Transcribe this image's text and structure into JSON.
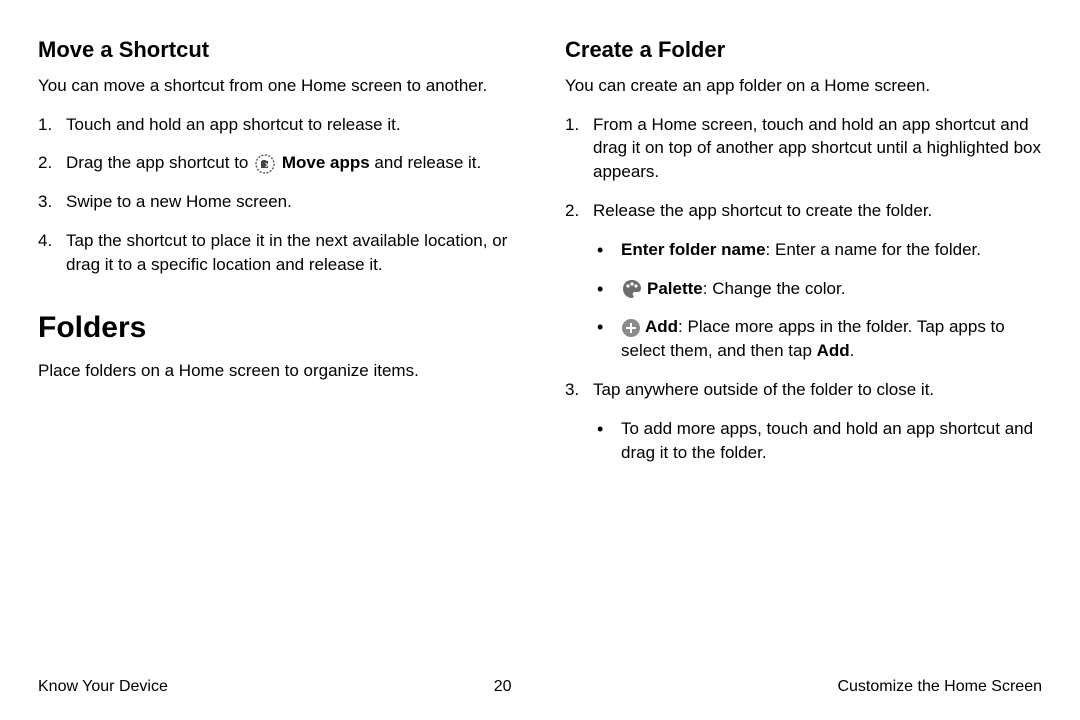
{
  "left": {
    "move_h": "Move a Shortcut",
    "move_intro": "You can move a shortcut from one Home screen to another.",
    "move_s1": "Touch and hold an app shortcut to release it.",
    "move_s2a": "Drag the app shortcut to ",
    "move_s2_bold": "Move apps",
    "move_s2b": " and release it.",
    "move_s3": "Swipe to a new Home screen.",
    "move_s4": "Tap the shortcut to place it in the next available location, or drag it to a specific location and release it.",
    "folders_h": "Folders",
    "folders_intro": "Place folders on a Home screen to organize items."
  },
  "right": {
    "create_h": "Create a Folder",
    "create_intro": "You can create an app folder on a Home screen.",
    "create_s1": "From a Home screen, touch and hold an app shortcut and drag it on top of another app shortcut until a highlighted box appears.",
    "create_s2": "Release the app shortcut to create the folder.",
    "b1_bold": "Enter folder name",
    "b1_rest": ": Enter a name for the folder.",
    "b2_bold": "Palette",
    "b2_rest": ": Change the color.",
    "b3_bold": "Add",
    "b3_rest_a": ": Place more apps in the folder. Tap apps to select them, and then tap ",
    "b3_rest_b": "Add",
    "b3_rest_c": ".",
    "create_s3": "Tap anywhere outside of the folder to close it.",
    "s3_b1": "To add more apps, touch and hold an app shortcut and drag it to the folder."
  },
  "footer": {
    "left": "Know Your Device",
    "center": "20",
    "right": "Customize the Home Screen"
  }
}
